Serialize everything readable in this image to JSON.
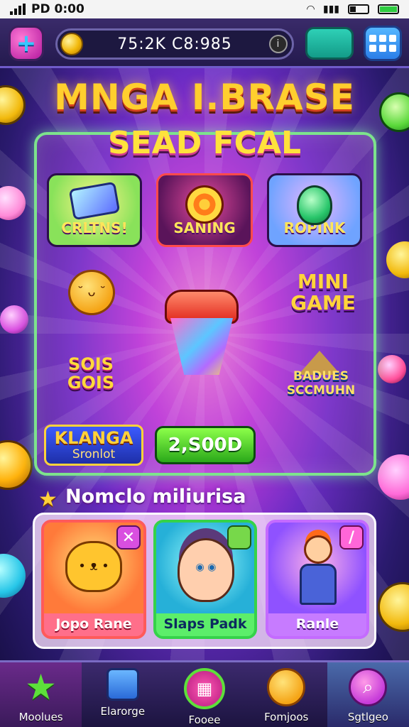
{
  "status_bar": {
    "left_text": "PD 0:00"
  },
  "hud": {
    "coins_value": "75:2K C8:985",
    "info_glyph": "i",
    "add_glyph": "+"
  },
  "titles": {
    "line1": "MNGA I.BRASE",
    "line2": "SEAD FCAL"
  },
  "board": {
    "tiles": [
      {
        "label": "CRLTNS!",
        "icon": "gem-cube-icon"
      },
      {
        "label": "SANING",
        "icon": "target-icon"
      },
      {
        "label": "ROPINK",
        "icon": "potion-icon"
      }
    ],
    "mini_game": "MINI GAME",
    "sois_text": "SOIS GOIS",
    "badges_text": "BADUES SCCMUHN",
    "left_button": {
      "line1": "KLANGA",
      "line2": "Sronlot"
    },
    "green_button": "2,S00D"
  },
  "section": {
    "title": "Nomclo miliurisa"
  },
  "cards": [
    {
      "label": "Jopo Rane",
      "corner": "✕"
    },
    {
      "label": "Slaps Padk",
      "corner": ""
    },
    {
      "label": "Ranle",
      "corner": "/"
    }
  ],
  "bottom_nav": [
    {
      "label": "Moolues"
    },
    {
      "label": "Elarorge"
    },
    {
      "label": "Fooee"
    },
    {
      "label": "Fomjoos"
    },
    {
      "label": "Sgtlgeo"
    }
  ],
  "colors": {
    "title_gold": "#ffcf2e",
    "board_border": "#7de38c",
    "accent_pink": "#c63bd9",
    "nav_background": "#241a4e"
  }
}
